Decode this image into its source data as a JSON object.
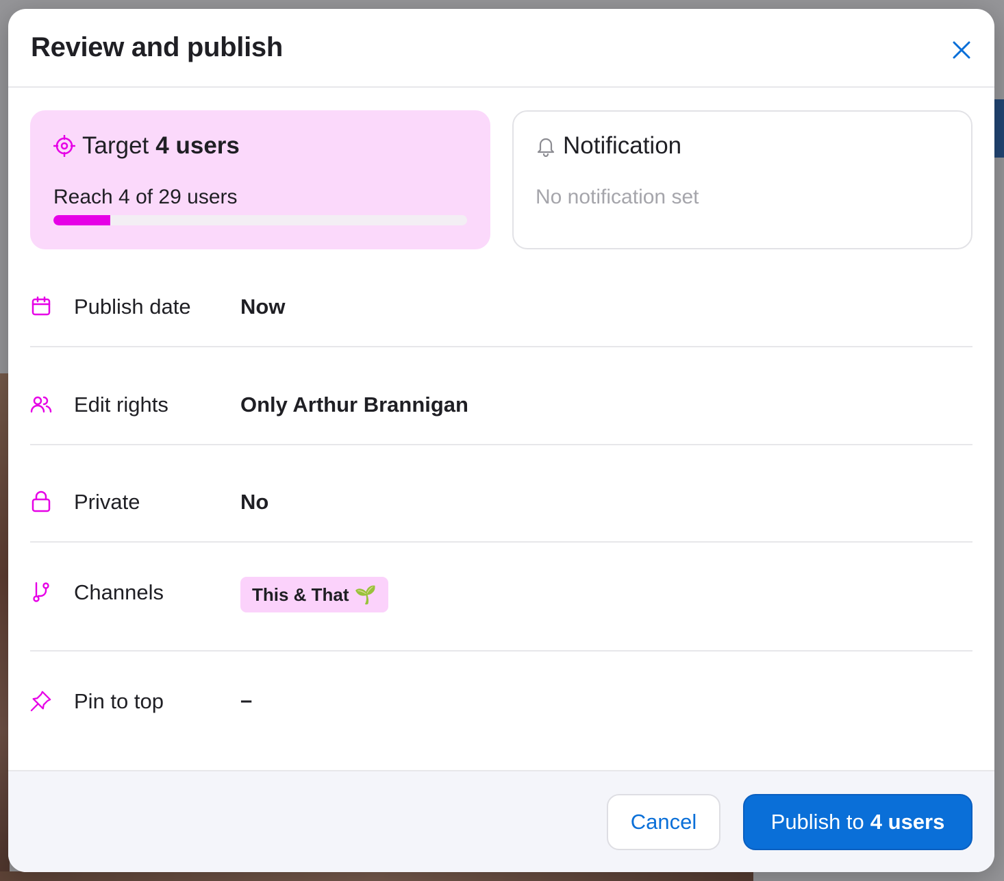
{
  "modal": {
    "title": "Review and publish"
  },
  "target_card": {
    "title_prefix": "Target",
    "title_bold": "4 users",
    "reach_text": "Reach 4 of 29 users",
    "reached": 4,
    "total": 29
  },
  "notification_card": {
    "title": "Notification",
    "subtitle": "No notification set"
  },
  "rows": {
    "publish_date": {
      "label": "Publish date",
      "value": "Now"
    },
    "edit_rights": {
      "label": "Edit rights",
      "value": "Only Arthur Brannigan"
    },
    "private": {
      "label": "Private",
      "value": "No"
    },
    "channels": {
      "label": "Channels",
      "chip": "This & That",
      "chip_emoji": "🌱"
    },
    "pin_to_top": {
      "label": "Pin to top",
      "value": "–"
    }
  },
  "footer": {
    "cancel_label": "Cancel",
    "publish_prefix": "Publish to",
    "publish_bold": "4 users"
  },
  "colors": {
    "accent_magenta": "#e600e6",
    "target_card_bg": "#fbd9fb",
    "primary_blue": "#0a6fd8"
  },
  "icons": {
    "close": "close-icon",
    "target": "target-icon",
    "notification": "bell-icon",
    "publish_date": "calendar-icon",
    "edit_rights": "users-icon",
    "private": "lock-icon",
    "channels": "branch-icon",
    "pin_to_top": "pin-icon"
  }
}
